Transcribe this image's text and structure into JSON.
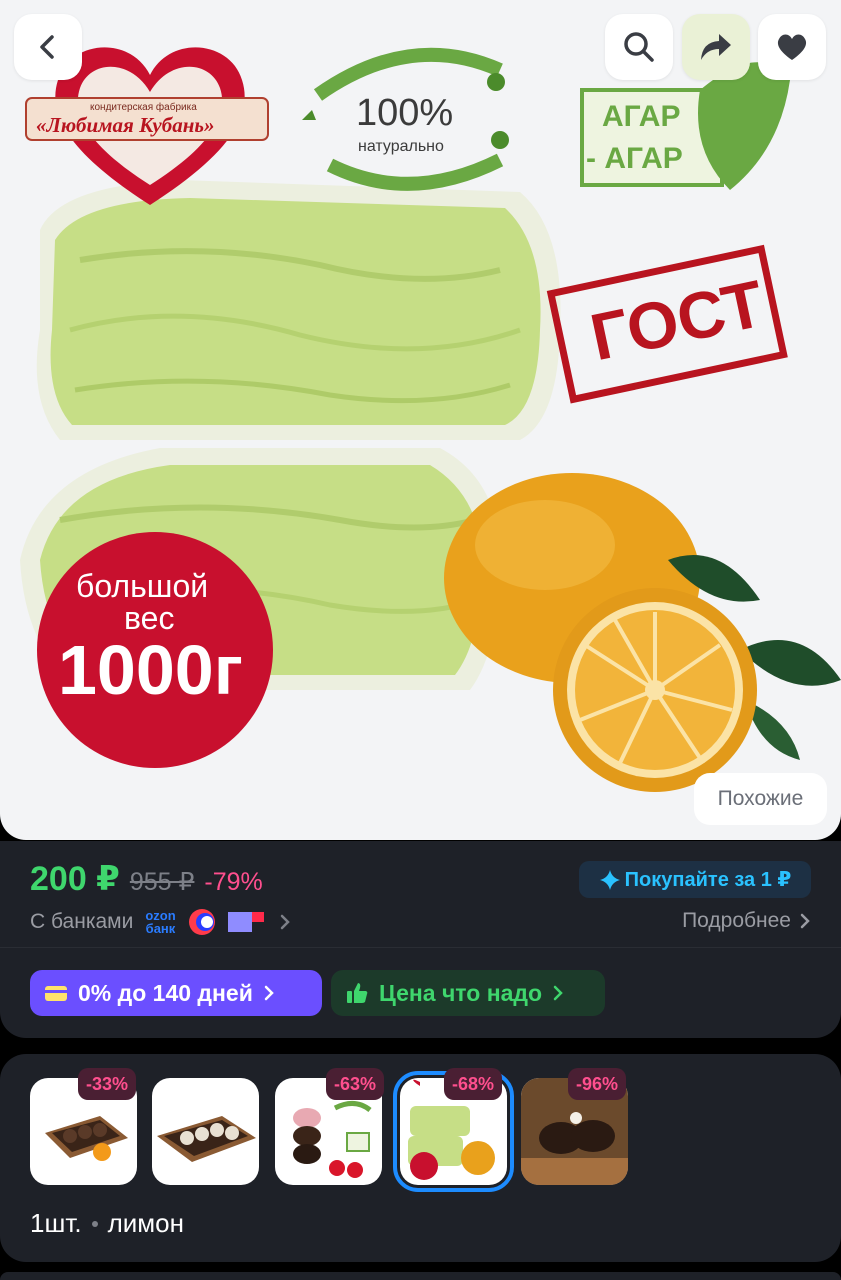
{
  "product_image": {
    "brand_top": "кондитерская фабрика",
    "brand_name": "«Любимая Кубань»",
    "natural_percent": "100%",
    "natural_text": "натурально",
    "agar_line1": "АГАР",
    "agar_line2": "- АГАР",
    "gost": "ГОСТ",
    "weight_line1": "большой",
    "weight_line2": "вес",
    "weight_value": "1000г",
    "similar_button": "Похожие"
  },
  "price": {
    "current": "200 ₽",
    "old": "955 ₽",
    "discount": "-79%",
    "promo": "Покупайте за 1 ₽",
    "banks_label": "С банками",
    "ozon_line1": "ozon",
    "ozon_line2": "банк",
    "details_link": "Подробнее",
    "installment": "0% до 140 дней",
    "price_label": "Цена что надо"
  },
  "variants": {
    "items": [
      {
        "discount": ""
      },
      {
        "discount": "-33%"
      },
      {
        "discount": "-63%"
      },
      {
        "discount": "-68%"
      },
      {
        "discount": "-96%"
      }
    ],
    "quantity": "1шт.",
    "flavor": "лимон"
  },
  "colors": {
    "price_green": "#3fd66d",
    "discount_pink": "#ff4f8e",
    "promo_blue": "#2ac2ff",
    "installment_purple": "#6b4fff",
    "card_bg": "#1e2128",
    "selected_outline": "#1d8cff"
  }
}
